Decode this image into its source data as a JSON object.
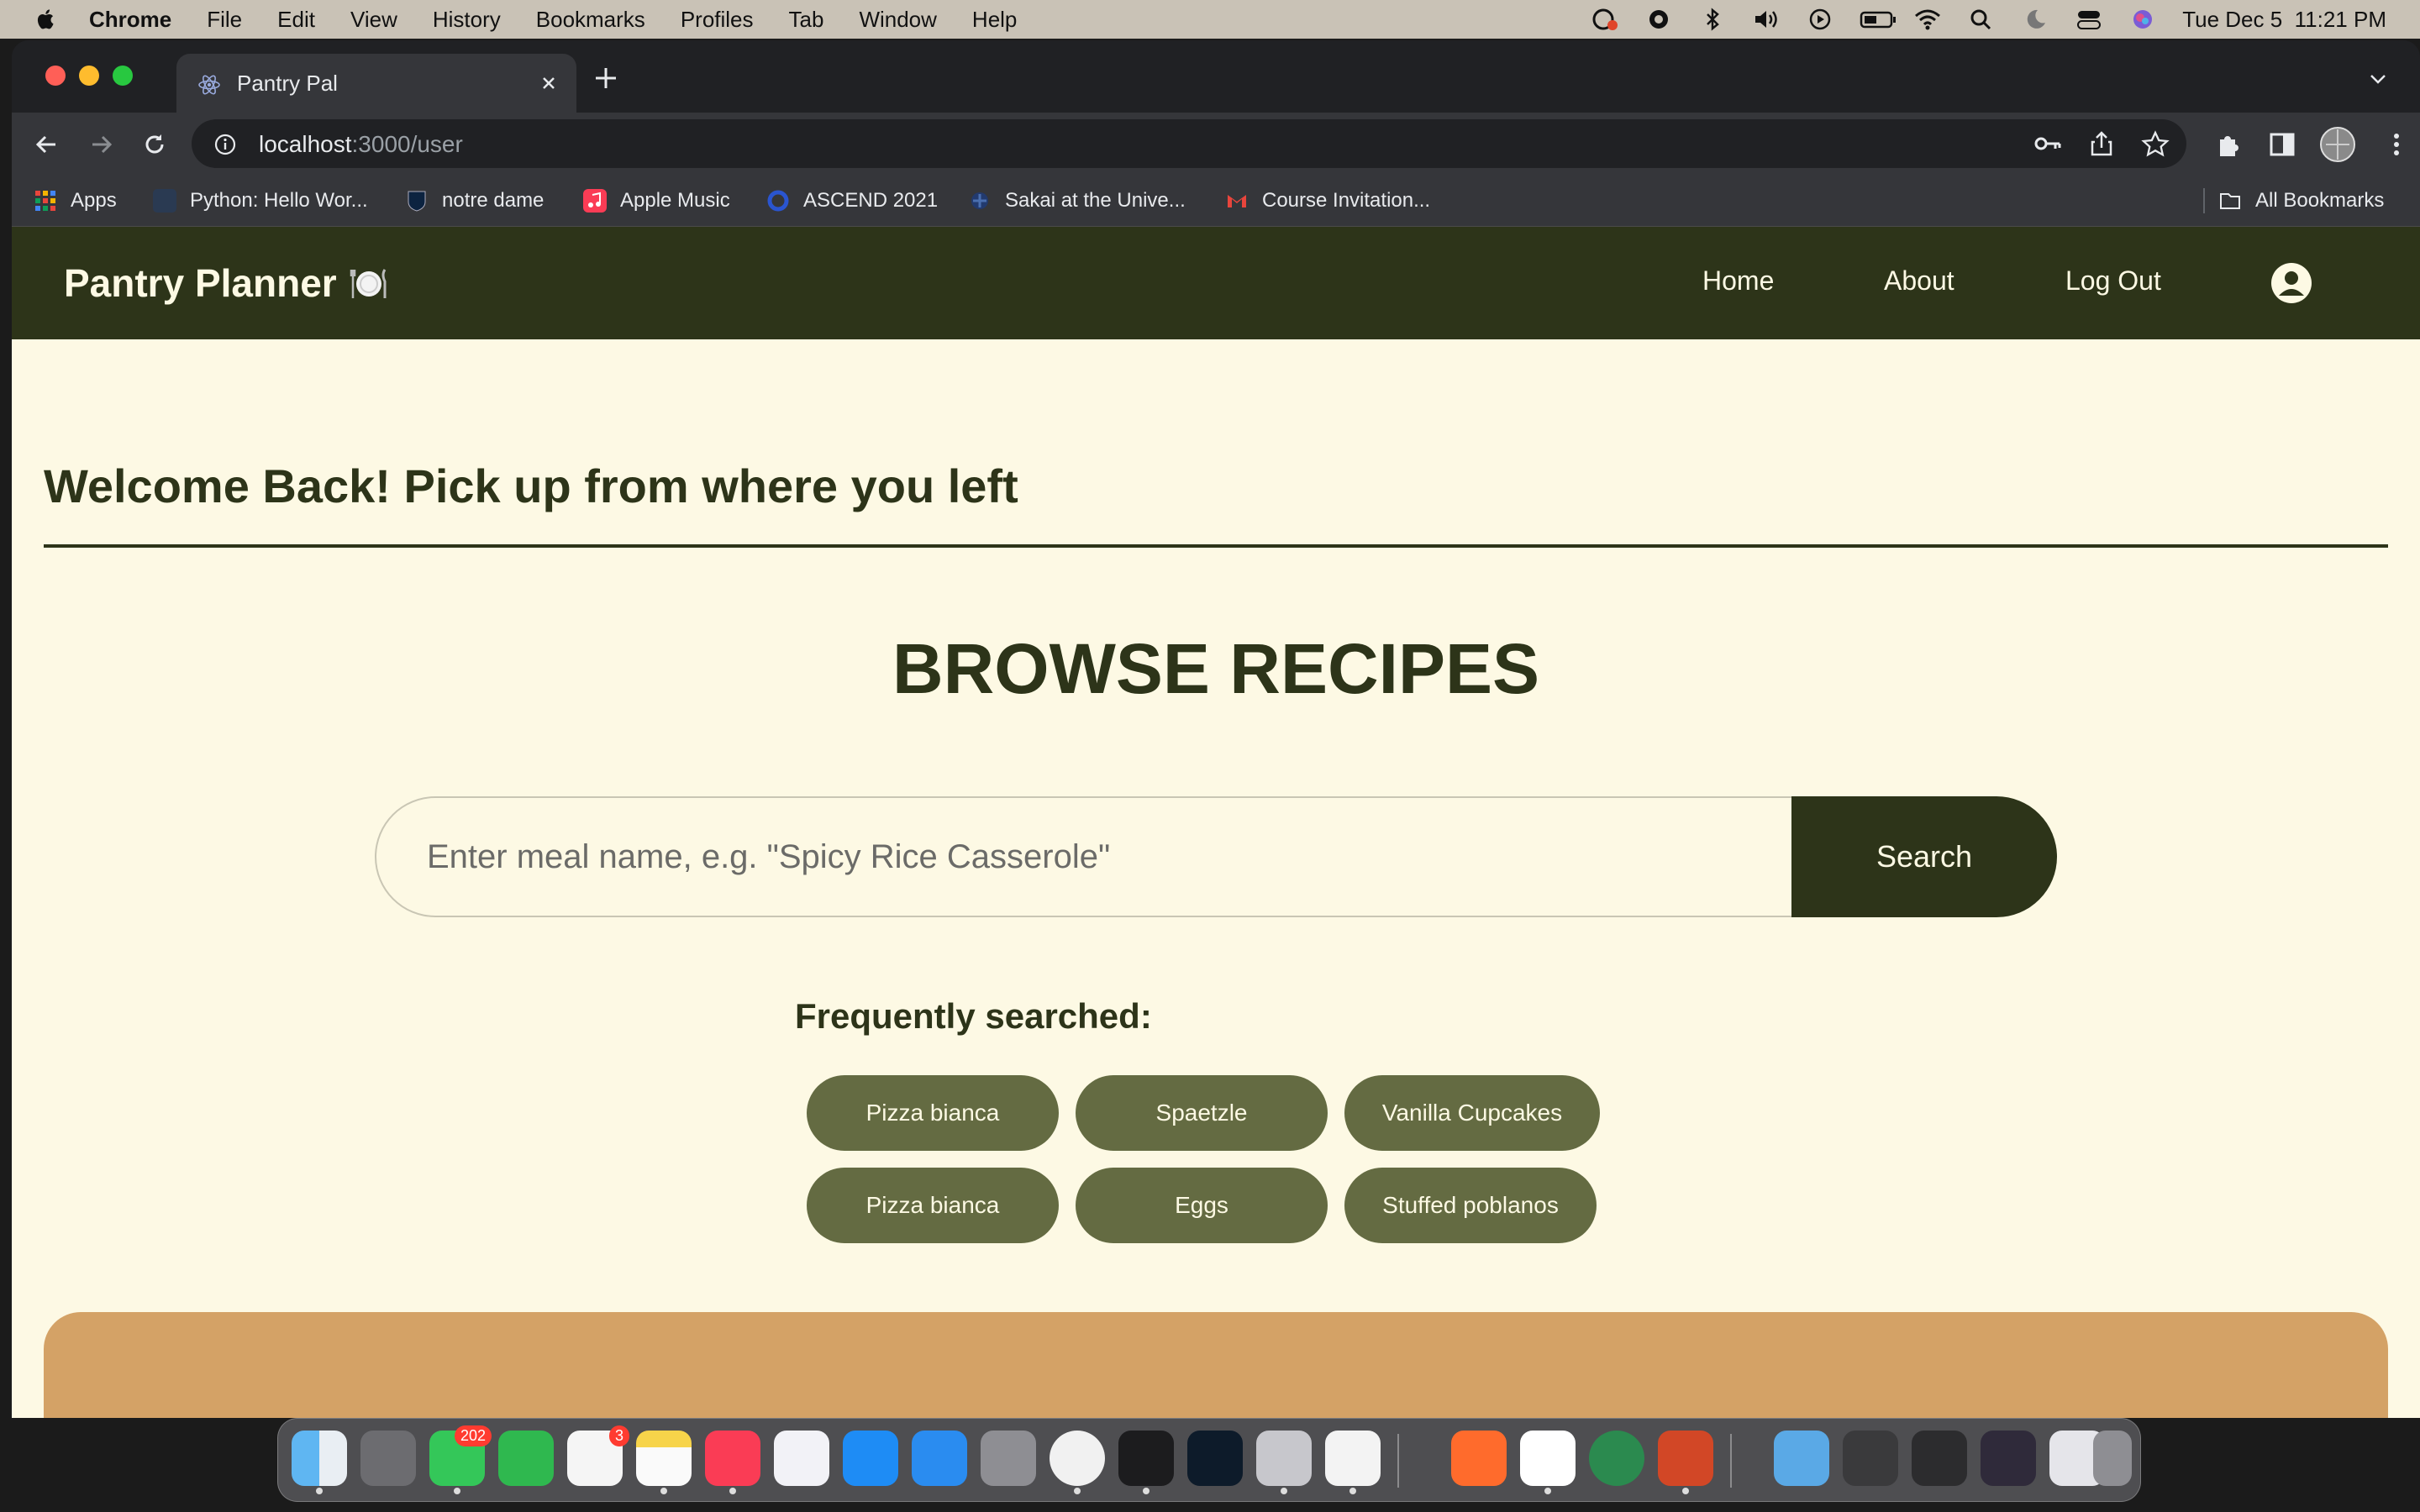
{
  "menubar": {
    "app": "Chrome",
    "items": [
      "File",
      "Edit",
      "View",
      "History",
      "Bookmarks",
      "Profiles",
      "Tab",
      "Window",
      "Help"
    ],
    "datetime": "Tue Dec 5  11:21 PM"
  },
  "browser": {
    "tab_title": "Pantry Pal",
    "url_host": "localhost",
    "url_path": ":3000/user",
    "bookmarks": [
      "Apps",
      "Python: Hello Wor...",
      "notre dame",
      "Apple Music",
      "ASCEND 2021",
      "Sakai at the Unive...",
      "Course Invitation..."
    ],
    "all_bookmarks": "All Bookmarks"
  },
  "nav": {
    "brand": "Pantry Planner",
    "home": "Home",
    "about": "About",
    "logout": "Log Out"
  },
  "main": {
    "welcome": "Welcome Back! Pick up from where you left",
    "browse_title": "BROWSE RECIPES",
    "search_placeholder": "Enter meal name, e.g. \"Spicy Rice Casserole\"",
    "search_button": "Search",
    "frequent_label": "Frequently searched:",
    "frequent": [
      "Pizza bianca",
      "Spaetzle",
      "Vanilla Cupcakes",
      "Pizza bianca",
      "Eggs",
      "Stuffed poblanos"
    ]
  },
  "dock": {
    "messages_badge": "202",
    "reminders_badge": "3"
  },
  "colors": {
    "nav_bg": "#2d3419",
    "page_bg": "#fdf9e4",
    "chip_bg": "#646b42",
    "card_bg": "#d4a266"
  }
}
